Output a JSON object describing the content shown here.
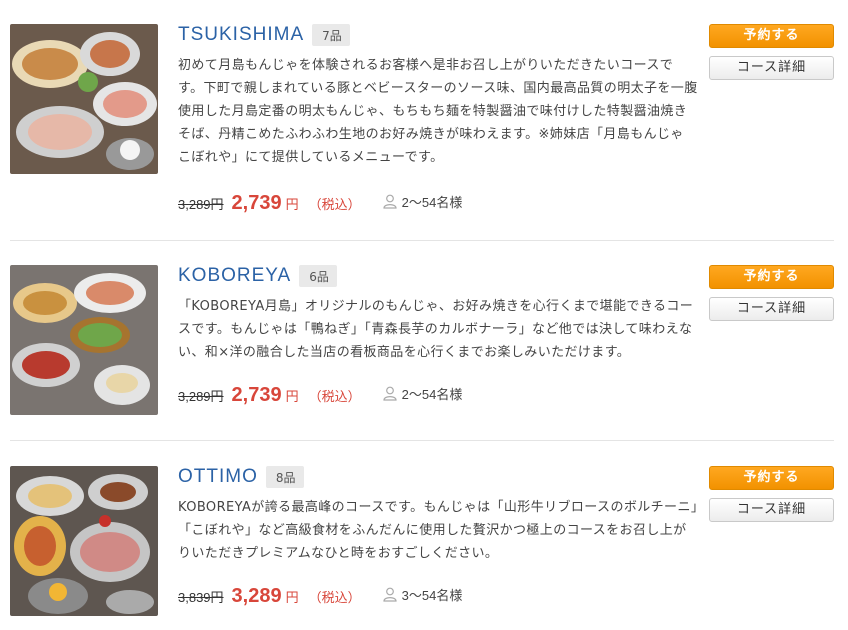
{
  "courses": [
    {
      "name": "TSUKISHIMA",
      "count": "7品",
      "description": "初めて月島もんじゃを体験されるお客様へ是非お召し上がりいただきたいコースです。下町で親しまれている豚とベビースターのソース味、国内最高品質の明太子を一腹使用した月島定番の明太もんじゃ、もちもち麺を特製醤油で味付けした特製醤油焼きそば、丹精こめたふわふわ生地のお好み焼きが味わえます。※姉妹店「月島もんじゃ こぼれや」にて提供しているメニューです。",
      "old_price": "3,289円",
      "price": "2,739",
      "yen": "円",
      "tax": "（税込）",
      "guests": "2〜54名様",
      "reserve_label": "予約する",
      "detail_label": "コース詳細"
    },
    {
      "name": "KOBOREYA",
      "count": "6品",
      "description": "「KOBOREYA月島」オリジナルのもんじゃ、お好み焼きを心行くまで堪能できるコースです。もんじゃは「鴨ねぎ」「青森長芋のカルボナーラ」など他では決して味わえない、和×洋の融合した当店の看板商品を心行くまでお楽しみいただけます。",
      "old_price": "3,289円",
      "price": "2,739",
      "yen": "円",
      "tax": "（税込）",
      "guests": "2〜54名様",
      "reserve_label": "予約する",
      "detail_label": "コース詳細"
    },
    {
      "name": "OTTIMO",
      "count": "8品",
      "description": "KOBOREYAが誇る最高峰のコースです。もんじゃは「山形牛リブロースのボルチーニ」「こぼれや」など高級食材をふんだんに使用した贅沢かつ極上のコースをお召し上がりいただきプレミアムなひと時をおすごしください。",
      "old_price": "3,839円",
      "price": "3,289",
      "yen": "円",
      "tax": "（税込）",
      "guests": "3〜54名様",
      "reserve_label": "予約する",
      "detail_label": "コース詳細"
    }
  ],
  "colors": {
    "accent_orange": "#f29200",
    "title_blue": "#2b62a6",
    "price_red": "#d8463a"
  }
}
